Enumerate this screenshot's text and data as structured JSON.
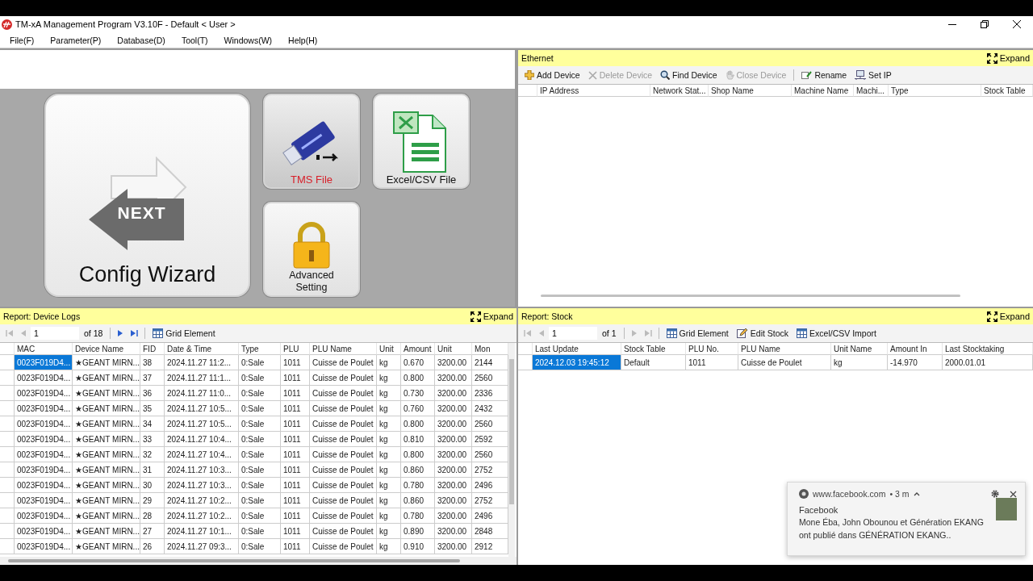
{
  "window": {
    "title": "TM-xA Management Program V3.10F - Default < User >"
  },
  "menu": [
    "File(F)",
    "Parameter(P)",
    "Database(D)",
    "Tool(T)",
    "Windows(W)",
    "Help(H)"
  ],
  "launcher": {
    "tiles": [
      {
        "kind": "wizard",
        "label": "Config Wizard",
        "badge": "NEXT"
      },
      {
        "kind": "tms",
        "label": "TMS File"
      },
      {
        "kind": "excel",
        "label": "Excel/CSV File"
      },
      {
        "kind": "advanced",
        "label": "Advanced Setting"
      }
    ]
  },
  "ethernet": {
    "title": "Ethernet",
    "expand": "Expand",
    "toolbar": [
      {
        "label": "Add Device",
        "disabled": false
      },
      {
        "label": "Delete Device",
        "disabled": true
      },
      {
        "label": "Find Device",
        "disabled": false
      },
      {
        "label": "Close Device",
        "disabled": true
      },
      {
        "label": "Rename",
        "disabled": false
      },
      {
        "label": "Set IP",
        "disabled": false
      }
    ],
    "columns": [
      "IP Address",
      "Network Stat...",
      "Shop Name",
      "Machine Name",
      "Machi...",
      "Type",
      "Stock Table"
    ]
  },
  "device_logs": {
    "title": "Report: Device Logs",
    "expand": "Expand",
    "pager": {
      "page": "1",
      "total": "of 18",
      "back_enabled": false,
      "forward_enabled": true
    },
    "tools": [
      "Grid Element"
    ],
    "columns": [
      "MAC",
      "Device Name",
      "FID",
      "Date & Time",
      "Type",
      "PLU",
      "PLU Name",
      "Unit",
      "Amount",
      "Unit",
      "Mon"
    ],
    "rows": [
      {
        "selected": true,
        "cells": [
          "0023F019D4...",
          "★GEANT MIRN...",
          "38",
          "2024.11.27 11:2...",
          "0:Sale",
          "1011",
          "Cuisse de Poulet",
          "kg",
          "0.670",
          "3200.00",
          "2144"
        ]
      },
      {
        "selected": false,
        "cells": [
          "0023F019D4...",
          "★GEANT MIRN...",
          "37",
          "2024.11.27 11:1...",
          "0:Sale",
          "1011",
          "Cuisse de Poulet",
          "kg",
          "0.800",
          "3200.00",
          "2560"
        ]
      },
      {
        "selected": false,
        "cells": [
          "0023F019D4...",
          "★GEANT MIRN...",
          "36",
          "2024.11.27 11:0...",
          "0:Sale",
          "1011",
          "Cuisse de Poulet",
          "kg",
          "0.730",
          "3200.00",
          "2336"
        ]
      },
      {
        "selected": false,
        "cells": [
          "0023F019D4...",
          "★GEANT MIRN...",
          "35",
          "2024.11.27 10:5...",
          "0:Sale",
          "1011",
          "Cuisse de Poulet",
          "kg",
          "0.760",
          "3200.00",
          "2432"
        ]
      },
      {
        "selected": false,
        "cells": [
          "0023F019D4...",
          "★GEANT MIRN...",
          "34",
          "2024.11.27 10:5...",
          "0:Sale",
          "1011",
          "Cuisse de Poulet",
          "kg",
          "0.800",
          "3200.00",
          "2560"
        ]
      },
      {
        "selected": false,
        "cells": [
          "0023F019D4...",
          "★GEANT MIRN...",
          "33",
          "2024.11.27 10:4...",
          "0:Sale",
          "1011",
          "Cuisse de Poulet",
          "kg",
          "0.810",
          "3200.00",
          "2592"
        ]
      },
      {
        "selected": false,
        "cells": [
          "0023F019D4...",
          "★GEANT MIRN...",
          "32",
          "2024.11.27 10:4...",
          "0:Sale",
          "1011",
          "Cuisse de Poulet",
          "kg",
          "0.800",
          "3200.00",
          "2560"
        ]
      },
      {
        "selected": false,
        "cells": [
          "0023F019D4...",
          "★GEANT MIRN...",
          "31",
          "2024.11.27 10:3...",
          "0:Sale",
          "1011",
          "Cuisse de Poulet",
          "kg",
          "0.860",
          "3200.00",
          "2752"
        ]
      },
      {
        "selected": false,
        "cells": [
          "0023F019D4...",
          "★GEANT MIRN...",
          "30",
          "2024.11.27 10:3...",
          "0:Sale",
          "1011",
          "Cuisse de Poulet",
          "kg",
          "0.780",
          "3200.00",
          "2496"
        ]
      },
      {
        "selected": false,
        "cells": [
          "0023F019D4...",
          "★GEANT MIRN...",
          "29",
          "2024.11.27 10:2...",
          "0:Sale",
          "1011",
          "Cuisse de Poulet",
          "kg",
          "0.860",
          "3200.00",
          "2752"
        ]
      },
      {
        "selected": false,
        "cells": [
          "0023F019D4...",
          "★GEANT MIRN...",
          "28",
          "2024.11.27 10:2...",
          "0:Sale",
          "1011",
          "Cuisse de Poulet",
          "kg",
          "0.780",
          "3200.00",
          "2496"
        ]
      },
      {
        "selected": false,
        "cells": [
          "0023F019D4...",
          "★GEANT MIRN...",
          "27",
          "2024.11.27 10:1...",
          "0:Sale",
          "1011",
          "Cuisse de Poulet",
          "kg",
          "0.890",
          "3200.00",
          "2848"
        ]
      },
      {
        "selected": false,
        "cells": [
          "0023F019D4...",
          "★GEANT MIRN...",
          "26",
          "2024.11.27 09:3...",
          "0:Sale",
          "1011",
          "Cuisse de Poulet",
          "kg",
          "0.910",
          "3200.00",
          "2912"
        ]
      }
    ]
  },
  "stock": {
    "title": "Report: Stock",
    "expand": "Expand",
    "pager": {
      "page": "1",
      "total": "of 1",
      "back_enabled": false,
      "forward_enabled": false
    },
    "tools": [
      "Grid Element",
      "Edit Stock",
      "Excel/CSV Import"
    ],
    "columns": [
      "Last Update",
      "Stock Table",
      "PLU No.",
      "PLU Name",
      "Unit Name",
      "Amount In",
      "Last Stocktaking"
    ],
    "rows": [
      {
        "selected": true,
        "cells": [
          "2024.12.03 19:45:12",
          "Default",
          "1011",
          "Cuisse de Poulet",
          "kg",
          "-14.970",
          "2000.01.01"
        ]
      }
    ]
  },
  "notification": {
    "source": "www.facebook.com",
    "age": "• 3 m",
    "title": "Facebook",
    "message": "Mone Éba, John Obounou et Génération EKANG ont publié dans GÉNÉRATION EKANG.."
  }
}
